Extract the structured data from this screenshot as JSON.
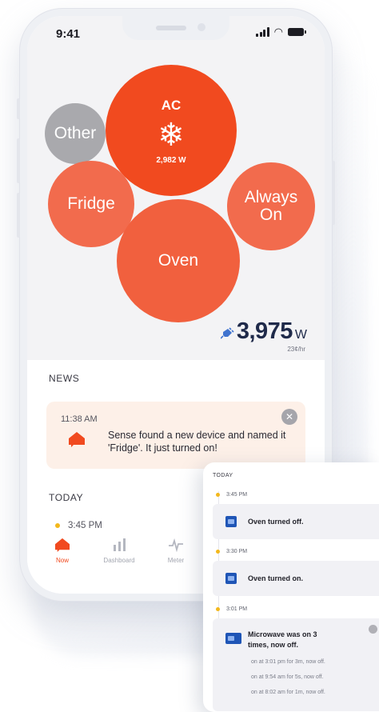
{
  "status_bar": {
    "time": "9:41"
  },
  "bubbles": {
    "ac": {
      "label": "AC",
      "watts": "2,982 W",
      "icon": "snowflake-icon"
    },
    "other": {
      "label": "Other"
    },
    "fridge": {
      "label": "Fridge"
    },
    "always_on": {
      "label": "Always On"
    },
    "oven": {
      "label": "Oven"
    }
  },
  "total": {
    "value": "3,975",
    "unit": "W",
    "rate": "23¢/hr"
  },
  "news": {
    "heading": "NEWS",
    "card": {
      "time": "11:38 AM",
      "text": "Sense found a new device and named it 'Fridge'. It just turned on!"
    }
  },
  "today": {
    "heading": "TODAY",
    "first_time": "3:45 PM"
  },
  "tabbar": [
    {
      "label": "Now",
      "active": true
    },
    {
      "label": "Dashboard",
      "active": false
    },
    {
      "label": "Meter",
      "active": false
    }
  ],
  "timeline": {
    "heading": "TODAY",
    "events": [
      {
        "time": "3:45 PM",
        "text": "Oven turned off."
      },
      {
        "time": "3:30 PM",
        "text": "Oven turned on."
      },
      {
        "time": "3:01 PM",
        "title_line1": "Microwave was on 3",
        "title_line2": "times, now off.",
        "details": [
          "on at 3:01 pm for 3m, now off.",
          "on at 9:54 am for 5s, now off.",
          "on at 8:02 am for 1m, now off."
        ]
      }
    ]
  },
  "colors": {
    "accent": "#f14a1f",
    "bubble_secondary": "#f26b4d",
    "bubble_other": "#a9a9ad",
    "total_text": "#1f2a4a",
    "news_card": "#fdf0e8",
    "device_icon": "#1f55b6"
  }
}
